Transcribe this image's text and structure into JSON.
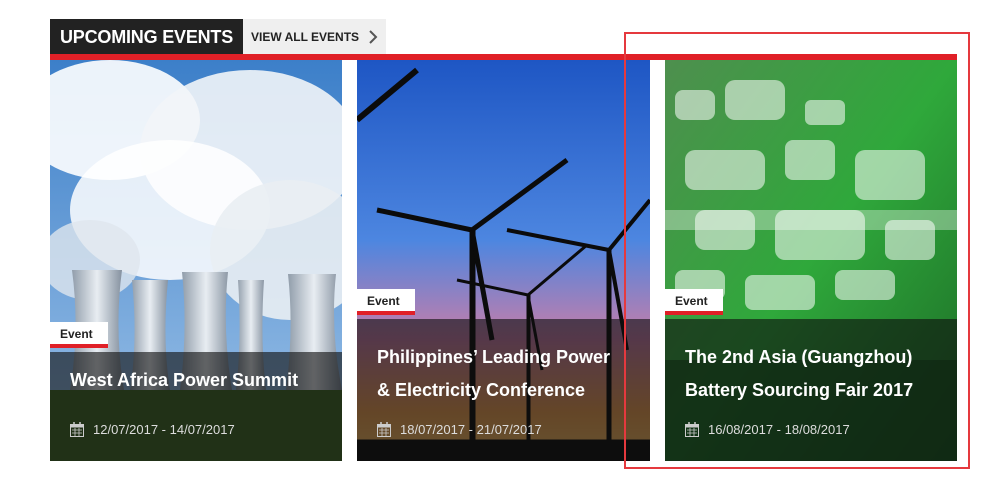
{
  "header": {
    "title": "UPCOMING EVENTS",
    "view_all_label": "VIEW ALL EVENTS",
    "chevron_icon": "chevron-right-icon"
  },
  "colors": {
    "accent": "#e02027",
    "header_bg": "#222222",
    "highlight_border": "#e5393e"
  },
  "events": [
    {
      "badge": "Event",
      "title_lines": [
        "West Africa Power Summit"
      ],
      "date": "12/07/2017 - 14/07/2017",
      "image": "cooling-towers-photo"
    },
    {
      "badge": "Event",
      "title_lines": [
        "Philippines’ Leading Power",
        "& Electricity Conference"
      ],
      "date": "18/07/2017 - 21/07/2017",
      "image": "wind-turbines-sunset-photo"
    },
    {
      "badge": "Event",
      "title_lines": [
        "The 2nd Asia (Guangzhou)",
        "Battery Sourcing Fair 2017"
      ],
      "date": "16/08/2017 - 18/08/2017",
      "image": "green-digital-abstract-photo"
    }
  ]
}
